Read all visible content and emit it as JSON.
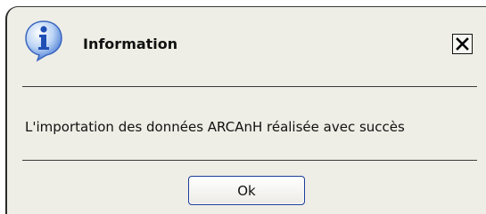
{
  "dialog": {
    "title": "Information",
    "title_icon": "info-icon",
    "close_icon": "close-icon",
    "message": "L'importation des données ARCAnH réalisée avec succès",
    "ok_label": "Ok"
  },
  "colors": {
    "background": "#eeeee6",
    "border": "#2a2a2a",
    "info_icon_blue": "#2a5fd0",
    "ok_button_border": "#1e3f9b"
  }
}
